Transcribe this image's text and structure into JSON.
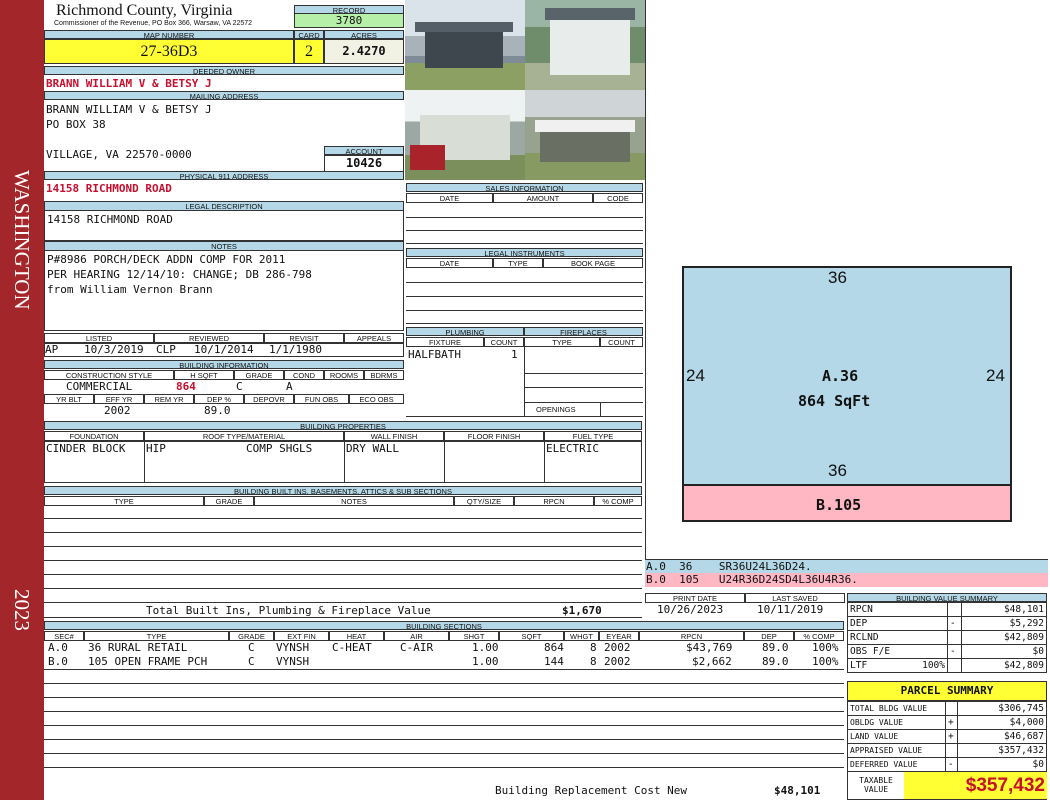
{
  "sidebar": {
    "district": "WASHINGTON",
    "year": "2023"
  },
  "header": {
    "county": "Richmond County, Virginia",
    "subtitle": "Commissioner of the Revenue, PO Box 366, Warsaw, VA 22572",
    "record_label": "RECORD",
    "record": "3780",
    "map_label": "MAP NUMBER",
    "map_number": "27-36D3",
    "card_label": "CARD",
    "card": "2",
    "acres_label": "ACRES",
    "acres": "2.4270"
  },
  "owner": {
    "label": "DEEDED OWNER",
    "name": "BRANN WILLIAM V & BETSY J",
    "mailing_label": "MAILING ADDRESS",
    "mail1": "BRANN WILLIAM V & BETSY J",
    "mail2": "PO BOX 38",
    "mail3": "VILLAGE, VA 22570-0000",
    "account_label": "ACCOUNT",
    "account": "10426"
  },
  "physical": {
    "label": "PHYSICAL 911 ADDRESS",
    "value": "14158 RICHMOND ROAD"
  },
  "legal": {
    "label": "LEGAL DESCRIPTION",
    "value": "14158 RICHMOND ROAD"
  },
  "notes": {
    "label": "NOTES",
    "l1": "P#8986 PORCH/DECK ADDN COMP FOR 2011",
    "l2": "PER HEARING 12/14/10: CHANGE; DB 286-798",
    "l3": "from William Vernon Brann"
  },
  "listed": {
    "listed_label": "LISTED",
    "reviewed_label": "REVIEWED",
    "revisit_label": "REVISIT",
    "appeals_label": "APPEALS",
    "by": "AP",
    "date": "10/3/2019",
    "rev_by": "CLP",
    "rev_date": "10/1/2014",
    "revisit": "1/1/1980"
  },
  "bldg_info": {
    "label": "BUILDING INFORMATION",
    "h": [
      "CONSTRUCTION STYLE",
      "H SQFT",
      "GRADE",
      "COND",
      "ROOMS",
      "BDRMS"
    ],
    "style": "COMMERCIAL",
    "hsqft": "864",
    "grade": "C",
    "cond": "A",
    "h2": [
      "YR BLT",
      "EFF YR",
      "REM YR",
      "DEP %",
      "DEPOVR",
      "FUN OBS",
      "ECO OBS"
    ],
    "eff": "2002",
    "dep": "89.0"
  },
  "sales": {
    "label": "SALES INFORMATION",
    "h": [
      "DATE",
      "AMOUNT",
      "CODE"
    ]
  },
  "instruments": {
    "label": "LEGAL INSTRUMENTS",
    "h": [
      "DATE",
      "TYPE",
      "BOOK PAGE"
    ]
  },
  "plumbing": {
    "label": "PLUMBING",
    "h": [
      "FIXTURE",
      "COUNT"
    ],
    "fixture": "HALFBATH",
    "count": "1"
  },
  "fireplaces": {
    "label": "FIREPLACES",
    "h": [
      "TYPE",
      "COUNT"
    ],
    "openings": "OPENINGS"
  },
  "props": {
    "label": "BUILDING PROPERTIES",
    "h": [
      "FOUNDATION",
      "ROOF TYPE/MATERIAL",
      "WALL FINISH",
      "FLOOR FINISH",
      "FUEL TYPE"
    ],
    "foundation": "CINDER BLOCK",
    "roof_type": "HIP",
    "roof_mat": "COMP SHGLS",
    "wall": "DRY WALL",
    "fuel": "ELECTRIC"
  },
  "builtins": {
    "label": "BUILDING BUILT INS, BASEMENTS, ATTICS & SUB SECTIONS",
    "h": [
      "TYPE",
      "GRADE",
      "NOTES",
      "QTY/SIZE",
      "RPCN",
      "% COMP"
    ],
    "total_label": "Total Built Ins, Plumbing & Fireplace Value",
    "total": "$1,670"
  },
  "dates": {
    "print_label": "PRINT DATE",
    "saved_label": "LAST SAVED",
    "print": "10/26/2023",
    "saved": "10/11/2019"
  },
  "sketch": {
    "a_label": "A.36",
    "a_area": "864 SqFt",
    "top": "36",
    "bottom": "36",
    "left": "24",
    "right": "24",
    "b_label": "B.105",
    "line_a": "A.0  36    SR36U24L36D24.",
    "line_b": "B.0  105   U24R36D24SD4L36U4R36."
  },
  "sections": {
    "label": "BUILDING SECTIONS",
    "h": [
      "SEC#",
      "TYPE",
      "GRADE",
      "EXT FIN",
      "HEAT",
      "AIR",
      "SHGT",
      "SQFT",
      "WHGT",
      "EYEAR",
      "RPCN",
      "DEP",
      "% COMP"
    ],
    "rows": [
      {
        "sec": "A.0",
        "type": "36 RURAL RETAIL",
        "grade": "C",
        "ext": "VYNSH",
        "heat": "C-HEAT",
        "air": "C-AIR",
        "shgt": "1.00",
        "sqft": "864",
        "whgt": "8",
        "eyear": "2002",
        "rpcn": "$43,769",
        "dep": "89.0",
        "comp": "100%"
      },
      {
        "sec": "B.0",
        "type": "105 OPEN FRAME PCH",
        "grade": "C",
        "ext": "VYNSH",
        "heat": "",
        "air": "",
        "shgt": "1.00",
        "sqft": "144",
        "whgt": "8",
        "eyear": "2002",
        "rpcn": "$2,662",
        "dep": "89.0",
        "comp": "100%"
      }
    ],
    "replacement_label": "Building Replacement Cost New",
    "replacement": "$48,101"
  },
  "value_summary": {
    "label": "BUILDING VALUE SUMMARY",
    "rpcn_l": "RPCN",
    "rpcn": "$48,101",
    "dep_l": "DEP",
    "dep_s": "-",
    "dep": "$5,292",
    "rclnd_l": "RCLND",
    "rclnd": "$42,809",
    "obs_l": "OBS F/E",
    "obs_s": "-",
    "obs": "$0",
    "ltf_l": "LTF",
    "ltf_p": "100%",
    "ltf": "$42,809"
  },
  "parcel": {
    "label": "PARCEL SUMMARY",
    "bldg_l": "TOTAL BLDG VALUE",
    "bldg": "$306,745",
    "obldg_l": "OBLDG VALUE",
    "obldg_s": "+",
    "obldg": "$4,000",
    "land_l": "LAND VALUE",
    "land_s": "+",
    "land": "$46,687",
    "appr_l": "APPRAISED VALUE",
    "appr": "$357,432",
    "def_l": "DEFERRED VALUE",
    "def_s": "-",
    "def": "$0",
    "tax_l1": "TAXABLE",
    "tax_l2": "VALUE",
    "tax": "$357,432"
  }
}
